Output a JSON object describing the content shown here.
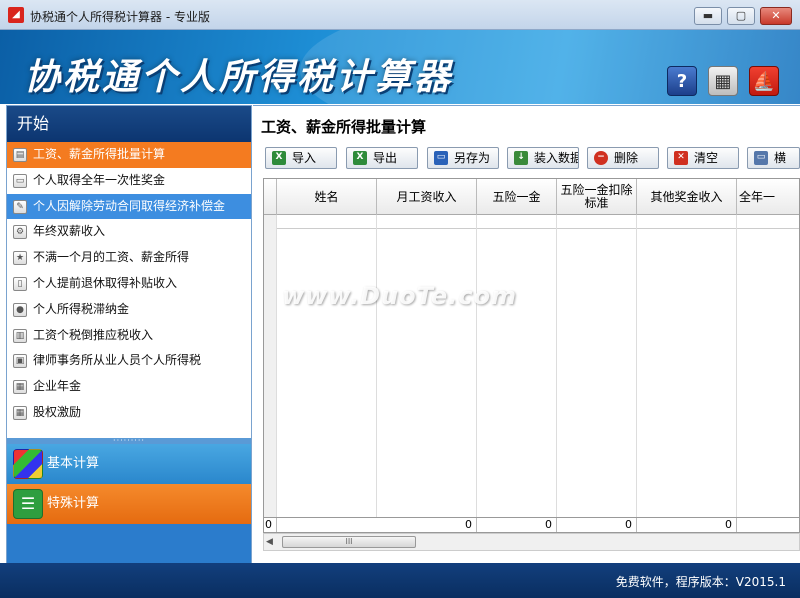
{
  "window": {
    "title": "协税通个人所得税计算器 - 专业版",
    "minimize": "▬",
    "maximize": "▢",
    "close": "✕"
  },
  "banner": {
    "title": "协税通个人所得税计算器",
    "help_icon": "?",
    "calc_icon": "▦",
    "brand_icon": "⛵"
  },
  "sidebar": {
    "header": "开始",
    "items": [
      {
        "label": "工资、薪金所得批量计算",
        "icon": "table-icon",
        "state": "active"
      },
      {
        "label": "个人取得全年一次性奖金",
        "icon": "document-icon",
        "state": ""
      },
      {
        "label": "个人因解除劳动合同取得经济补偿金",
        "icon": "edit-icon",
        "state": "hover"
      },
      {
        "label": "年终双薪收入",
        "icon": "gear-icon",
        "state": ""
      },
      {
        "label": "不满一个月的工资、薪金所得",
        "icon": "medal-icon",
        "state": ""
      },
      {
        "label": "个人提前退休取得补贴收入",
        "icon": "phone-icon",
        "state": ""
      },
      {
        "label": "个人所得税滞纳金",
        "icon": "coins-icon",
        "state": ""
      },
      {
        "label": "工资个税倒推应税收入",
        "icon": "book-icon",
        "state": ""
      },
      {
        "label": "律师事务所从业人员个人所得税",
        "icon": "window-icon",
        "state": ""
      },
      {
        "label": "企业年金",
        "icon": "calendar-icon",
        "state": ""
      },
      {
        "label": "股权激励",
        "icon": "calendar-icon",
        "state": ""
      }
    ],
    "splitter": "·········",
    "categories": [
      {
        "label": "基本计算",
        "icon": "grid-apps-icon"
      },
      {
        "label": "特殊计算",
        "icon": "list-icon"
      }
    ]
  },
  "main": {
    "title": "工资、薪金所得批量计算",
    "toolbar": [
      {
        "label": "导入",
        "icon": "excel-import-icon",
        "color": "#2e8b3a"
      },
      {
        "label": "导出",
        "icon": "excel-export-icon",
        "color": "#2e8b3a"
      },
      {
        "label": "另存为",
        "icon": "save-as-icon",
        "color": "#2a62b8"
      },
      {
        "label": "装入数据",
        "icon": "load-data-icon",
        "color": "#3a8a3a"
      },
      {
        "label": "删除",
        "icon": "delete-icon",
        "color": "#d03020"
      },
      {
        "label": "清空",
        "icon": "clear-icon",
        "color": "#d03020"
      },
      {
        "label": "横",
        "icon": "landscape-icon",
        "color": "#5577aa"
      }
    ],
    "grid": {
      "columns": [
        "",
        "姓名",
        "月工资收入",
        "五险一金",
        "五险一金扣除标准",
        "其他奖金收入",
        "全年一"
      ],
      "footer": [
        "0",
        "0",
        "0",
        "0",
        "0"
      ],
      "scroll_thumb": "III"
    }
  },
  "watermark": "www.DuoTe.com",
  "status": {
    "text": "免费软件，程序版本：V2015.1"
  },
  "colors": {
    "accent_orange": "#f47b20",
    "navy": "#0c3570",
    "banner_blue": "#1e8fd6"
  }
}
